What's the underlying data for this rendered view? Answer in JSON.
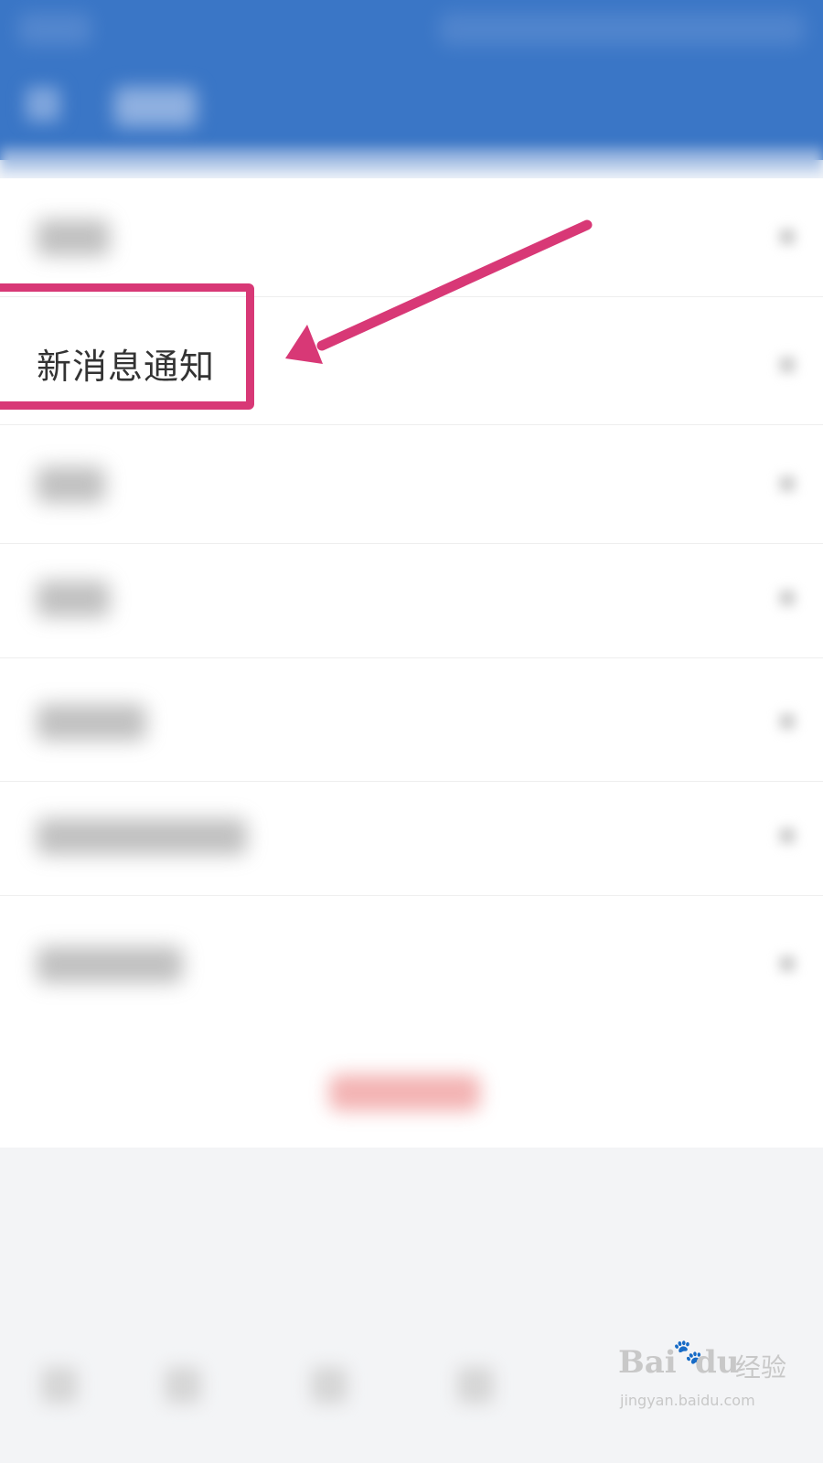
{
  "header": {
    "title": "",
    "back_icon": "back-arrow-icon"
  },
  "settings": {
    "items": [
      {
        "name": "row-account",
        "label": ""
      },
      {
        "name": "row-new-message-notification",
        "label": "新消息通知"
      },
      {
        "name": "row-privacy",
        "label": ""
      },
      {
        "name": "row-general",
        "label": ""
      },
      {
        "name": "row-about",
        "label": ""
      },
      {
        "name": "row-help",
        "label": ""
      },
      {
        "name": "row-switch-account",
        "label": ""
      }
    ],
    "logout_label": ""
  },
  "annotation": {
    "highlight_color": "#d83876",
    "arrow_color": "#d83876",
    "target": "新消息通知"
  },
  "watermark": {
    "logo": "Bai",
    "logo_tail": "du",
    "cn": "经验",
    "url": "jingyan.baidu.com"
  },
  "colors": {
    "header": "#3a76c6",
    "accent": "#d83876"
  }
}
